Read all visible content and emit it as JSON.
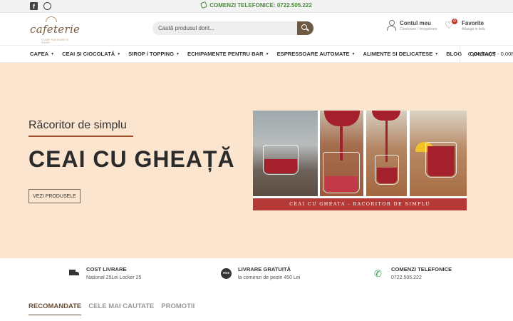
{
  "topbar": {
    "social_icons": [
      "facebook-icon",
      "whatsapp-icon"
    ],
    "phone_text": "COMENZI TELEFONICE: 0722.505.222"
  },
  "header": {
    "logo_word": "cafeterie",
    "logo_tag": "YOUR FAVOURITE SHOP",
    "search_placeholder": "Caută produsul dorit...",
    "account_title": "Contul meu",
    "account_sub": "Conectare / Inregistrare",
    "favorites_title": "Favorite",
    "favorites_sub": "Adauga in lista",
    "favorites_count": "0"
  },
  "nav": {
    "items": [
      {
        "label": "CAFEA",
        "dropdown": true
      },
      {
        "label": "CEAI ȘI CIOCOLATĂ",
        "dropdown": true
      },
      {
        "label": "SIROP / TOPPING",
        "dropdown": true
      },
      {
        "label": "ECHIPAMENTE PENTRU BAR",
        "dropdown": true
      },
      {
        "label": "ESPRESSOARE AUTOMATE",
        "dropdown": true
      },
      {
        "label": "ALIMENTE SI DELICATESE",
        "dropdown": true
      },
      {
        "label": "BLOG",
        "dropdown": false
      },
      {
        "label": "CONTACT",
        "dropdown": false
      }
    ],
    "cart_text": "0 produs(e) - 0,00RON"
  },
  "hero": {
    "subtitle": "Răcoritor de simplu",
    "title": "CEAI CU GHEAȚĂ",
    "cta_label": "VEZI PRODUSELE",
    "image_caption": "CEAI CU GHEATA - RACORITOR DE SIMPLU",
    "background": "#fbe5cf",
    "accent": "#b33a37"
  },
  "features": [
    {
      "icon": "truck-icon",
      "title": "COST LIVRARE",
      "text": "National 25Lei Locker 25"
    },
    {
      "icon": "free-delivery-icon",
      "title": "LIVRARE GRATUITĂ",
      "text": "la comenzi de peste 450 Lei"
    },
    {
      "icon": "phone-icon",
      "title": "COMENZI TELEFONICE",
      "text": "0722.505.222"
    }
  ],
  "tabs": {
    "items": [
      "RECOMANDATE",
      "CELE MAI CAUTATE",
      "PROMOTII"
    ],
    "active": "RECOMANDATE"
  }
}
